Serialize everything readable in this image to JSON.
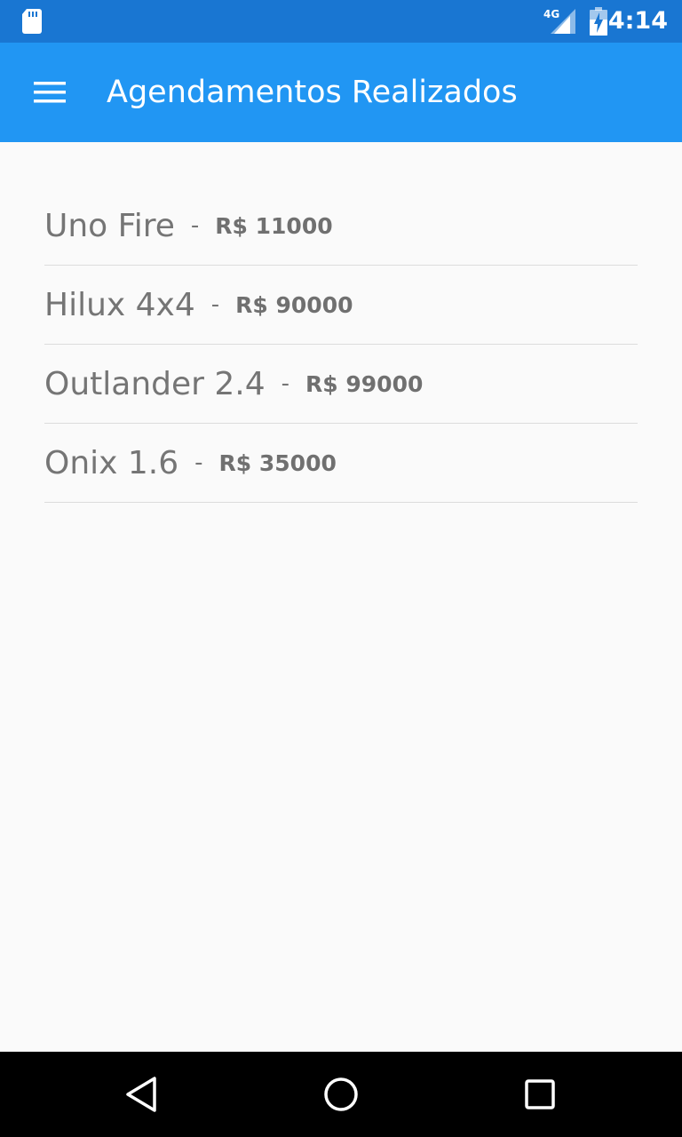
{
  "status_bar": {
    "network": "4G",
    "time": "4:14"
  },
  "app_bar": {
    "title": "Agendamentos Realizados",
    "menu_icon": "hamburger-menu-icon"
  },
  "list": {
    "separator": "-",
    "items": [
      {
        "name": "Uno Fire",
        "price": "R$ 11000"
      },
      {
        "name": "Hilux 4x4",
        "price": "R$ 90000"
      },
      {
        "name": "Outlander 2.4",
        "price": "R$ 99000"
      },
      {
        "name": "Onix 1.6",
        "price": "R$ 35000"
      }
    ]
  },
  "nav_bar": {
    "icons": [
      "back-icon",
      "home-icon",
      "recents-icon"
    ]
  },
  "colors": {
    "status_bar": "#1976d2",
    "app_bar": "#2196f3",
    "background": "#fafafa",
    "text": "#757575"
  }
}
